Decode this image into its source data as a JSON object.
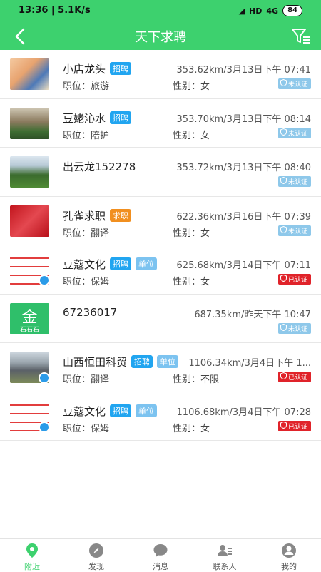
{
  "status_bar": {
    "time_speed": "13:36 | 5.1K/s",
    "battery": "84",
    "hd": "HD",
    "net": "4G"
  },
  "header": {
    "title": "天下求聘"
  },
  "colors": {
    "accent": "#3dd16e",
    "verified": "#e0232a",
    "unverified": "#8ec8ea"
  },
  "items": [
    {
      "name": "小店龙头",
      "tags": [
        {
          "text": "招聘",
          "color": "blue"
        }
      ],
      "meta": "353.62km/3月13日下午 07:41",
      "job": "职位：旅游",
      "gender": "性别：女",
      "verify": "未认证",
      "verified": false,
      "thumb": "child-photo"
    },
    {
      "name": "豆姥沁水",
      "tags": [
        {
          "text": "招聘",
          "color": "blue"
        }
      ],
      "meta": "353.70km/3月13日下午 08:14",
      "job": "职位：陪护",
      "gender": "性别：女",
      "verify": "未认证",
      "verified": false,
      "thumb": "plants-photo"
    },
    {
      "name": "出云龙152278",
      "tags": [],
      "meta": "353.72km/3月13日下午 08:40",
      "job": "",
      "gender": "",
      "verify": "未认证",
      "verified": false,
      "thumb": "lawn-photo"
    },
    {
      "name": "孔雀求职",
      "tags": [
        {
          "text": "求职",
          "color": "orange"
        }
      ],
      "meta": "622.36km/3月16日下午 07:39",
      "job": "职位：翻译",
      "gender": "性别：女",
      "verify": "未认证",
      "verified": false,
      "thumb": "red-photo"
    },
    {
      "name": "豆蔻文化",
      "tags": [
        {
          "text": "招聘",
          "color": "blue"
        },
        {
          "text": "单位",
          "color": "lightblue"
        }
      ],
      "meta": "625.68km/3月14日下午 07:11",
      "job": "职位：保姆",
      "gender": "性别：女",
      "verify": "已认证",
      "verified": true,
      "thumb": "doc-photo"
    },
    {
      "name": "67236017",
      "tags": [],
      "meta": "687.35km/昨天下午 10:47",
      "job": "",
      "gender": "",
      "verify": "未认证",
      "verified": false,
      "thumb": "gold-logo",
      "logo_text": "金",
      "logo_sub": "石石石"
    },
    {
      "name": "山西恒田科贸",
      "tags": [
        {
          "text": "招聘",
          "color": "blue"
        },
        {
          "text": "单位",
          "color": "lightblue"
        }
      ],
      "meta": "1106.34km/3月4日下午 1...",
      "job": "职位：翻译",
      "gender": "性别：不限",
      "verify": "已认证",
      "verified": true,
      "thumb": "building-photo"
    },
    {
      "name": "豆蔻文化",
      "tags": [
        {
          "text": "招聘",
          "color": "blue"
        },
        {
          "text": "单位",
          "color": "lightblue"
        }
      ],
      "meta": "1106.68km/3月4日下午 07:28",
      "job": "职位：保姆",
      "gender": "性别：女",
      "verify": "已认证",
      "verified": true,
      "thumb": "doc-photo"
    }
  ],
  "tabs": [
    {
      "label": "附近",
      "icon": "location-pin-icon",
      "active": true
    },
    {
      "label": "发现",
      "icon": "compass-icon",
      "active": false
    },
    {
      "label": "消息",
      "icon": "message-bubble-icon",
      "active": false
    },
    {
      "label": "联系人",
      "icon": "contacts-icon",
      "active": false
    },
    {
      "label": "我的",
      "icon": "profile-icon",
      "active": false
    }
  ]
}
